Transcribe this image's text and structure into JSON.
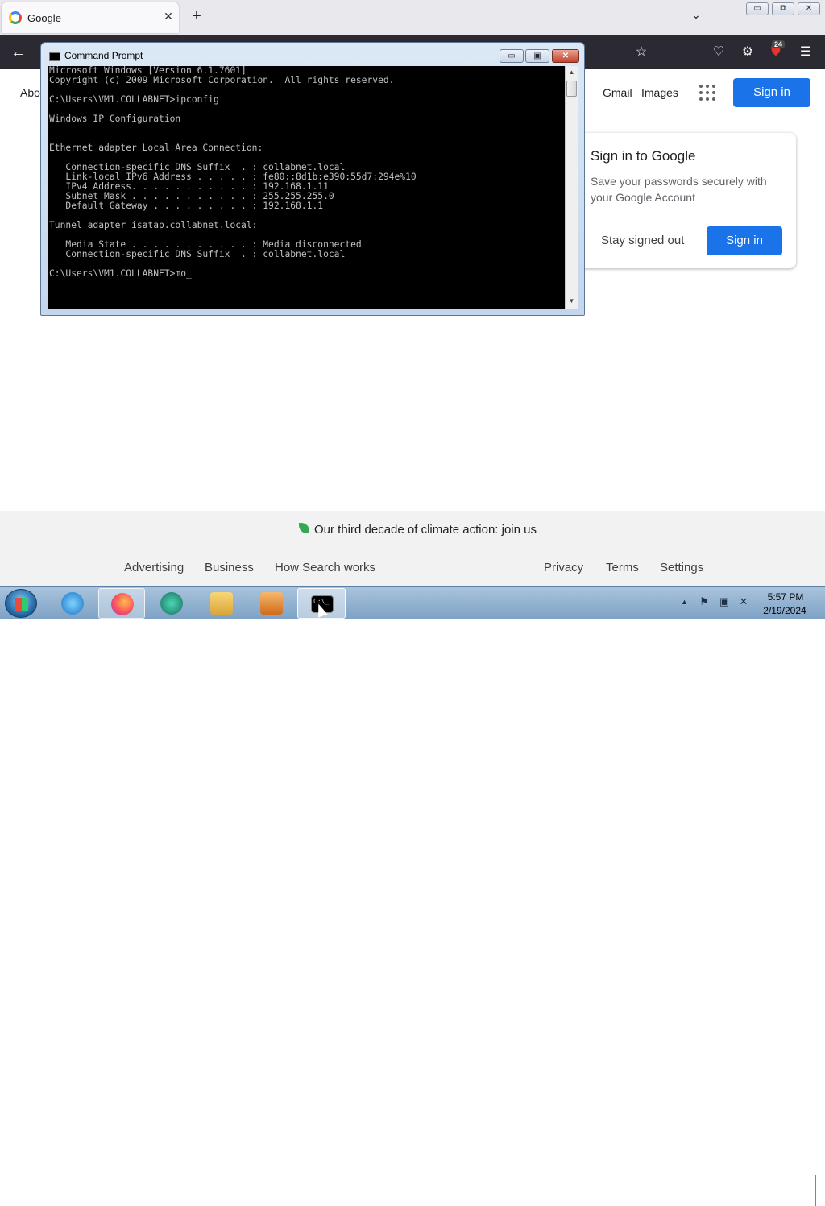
{
  "browser": {
    "tab_title": "Google",
    "tab_close": "✕",
    "new_tab": "+",
    "tab_list": "⌄",
    "win_min": "▭",
    "win_max": "⧉",
    "win_close": "✕",
    "back": "←",
    "toolbar_icons": {
      "star": "☆",
      "pocket": "♡",
      "extensions": "⚙",
      "ublock": "⛊",
      "menu": "☰"
    },
    "ublock_badge": "24"
  },
  "google": {
    "about": "Abo",
    "gmail": "Gmail",
    "images": "Images",
    "signin": "Sign in",
    "popup": {
      "title": "Sign in to Google",
      "desc": "Save your passwords securely with your Google Account",
      "stay_out": "Stay signed out",
      "signin": "Sign in"
    },
    "footer": {
      "climate": "Our third decade of climate action: join us",
      "links_left": [
        "Advertising",
        "Business",
        "How Search works"
      ],
      "links_right": [
        "Privacy",
        "Terms",
        "Settings"
      ]
    }
  },
  "cmd": {
    "title": "Command Prompt",
    "min": "▭",
    "max": "▣",
    "close": "✕",
    "lines": [
      "Microsoft Windows [Version 6.1.7601]",
      "Copyright (c) 2009 Microsoft Corporation.  All rights reserved.",
      "",
      "C:\\Users\\VM1.COLLABNET>ipconfig",
      "",
      "Windows IP Configuration",
      "",
      "",
      "Ethernet adapter Local Area Connection:",
      "",
      "   Connection-specific DNS Suffix  . : collabnet.local",
      "   Link-local IPv6 Address . . . . . : fe80::8d1b:e390:55d7:294e%10",
      "   IPv4 Address. . . . . . . . . . . : 192.168.1.11",
      "   Subnet Mask . . . . . . . . . . . : 255.255.255.0",
      "   Default Gateway . . . . . . . . . : 192.168.1.1",
      "",
      "Tunnel adapter isatap.collabnet.local:",
      "",
      "   Media State . . . . . . . . . . . : Media disconnected",
      "   Connection-specific DNS Suffix  . : collabnet.local",
      "",
      "C:\\Users\\VM1.COLLABNET>mo_"
    ],
    "scroll_up": "▲",
    "scroll_down": "▼"
  },
  "taskbar": {
    "cmd_glyph": "C:\\_",
    "tray_arrow": "▲",
    "tray_icons": {
      "flag": "⚑",
      "network": "▣",
      "volume": "✕"
    },
    "time": "5:57 PM",
    "date": "2/19/2024"
  }
}
